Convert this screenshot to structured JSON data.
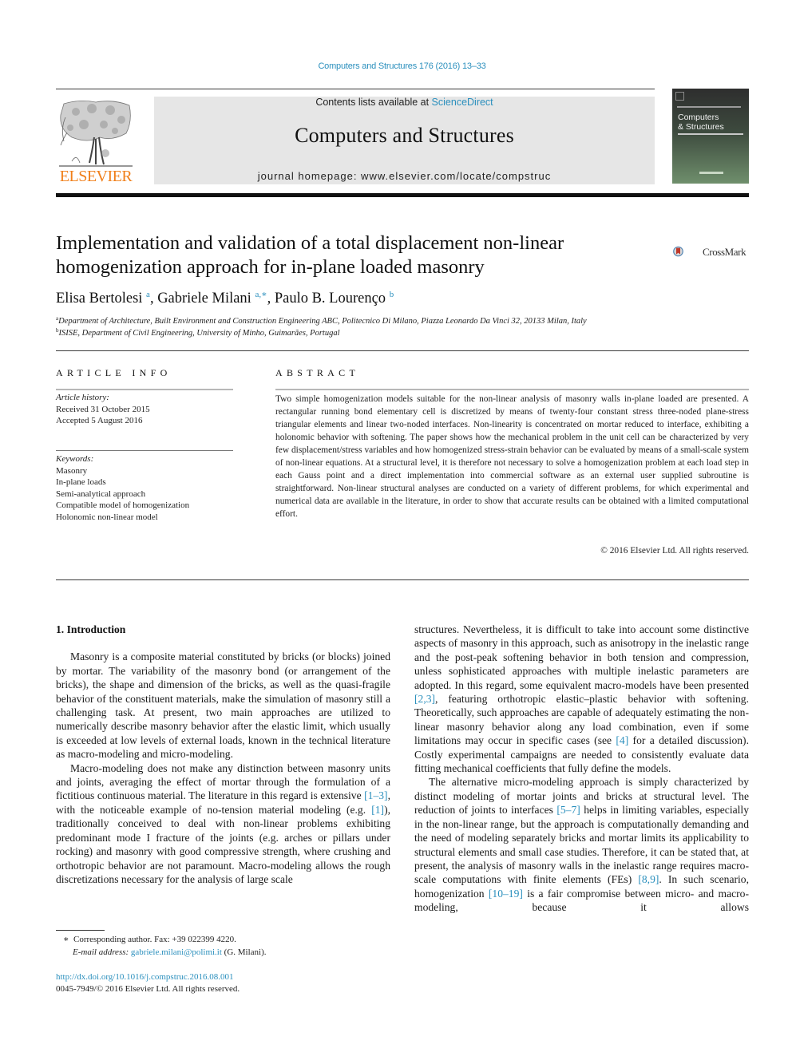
{
  "header": {
    "journal_ref": "Computers and Structures 176 (2016) 13–33",
    "contents_prefix": "Contents lists available at ",
    "contents_link": "ScienceDirect",
    "journal_name": "Computers and Structures",
    "homepage_label": "journal homepage: www.elsevier.com/locate/compstruc",
    "publisher_logo_text": "ELSEVIER",
    "cover_title_line1": "Computers",
    "cover_title_line2": "& Structures",
    "accent_color": "#2a8fbd",
    "publisher_color": "#f07f1a"
  },
  "article": {
    "title_line1": "Implementation and validation of a total displacement non-linear",
    "title_line2": "homogenization approach for in-plane loaded masonry",
    "crossmark_label": "CrossMark",
    "authors": [
      {
        "name": "Elisa Bertolesi",
        "sup": "a",
        "sep": ", "
      },
      {
        "name": "Gabriele Milani",
        "sup": "a,∗",
        "sep": ", "
      },
      {
        "name": "Paulo B. Lourenço",
        "sup": "b",
        "sep": ""
      }
    ],
    "affiliations": [
      {
        "mark": "a",
        "text": "Department of Architecture, Built Environment and Construction Engineering ABC, Politecnico Di Milano, Piazza Leonardo Da Vinci 32, 20133 Milan, Italy"
      },
      {
        "mark": "b",
        "text": "ISISE, Department of Civil Engineering, University of Minho, Guimarães, Portugal"
      }
    ]
  },
  "article_info": {
    "heading": "ARTICLE INFO",
    "history_label": "Article history:",
    "received": "Received 31 October 2015",
    "accepted": "Accepted 5 August 2016",
    "keywords_label": "Keywords:",
    "keywords": [
      "Masonry",
      "In-plane loads",
      "Semi-analytical approach",
      "Compatible model of homogenization",
      "Holonomic non-linear model"
    ]
  },
  "abstract": {
    "heading": "ABSTRACT",
    "text": "Two simple homogenization models suitable for the non-linear analysis of masonry walls in-plane loaded are presented. A rectangular running bond elementary cell is discretized by means of twenty-four constant stress three-noded plane-stress triangular elements and linear two-noded interfaces. Non-linearity is concentrated on mortar reduced to interface, exhibiting a holonomic behavior with softening. The paper shows how the mechanical problem in the unit cell can be characterized by very few displacement/stress variables and how homogenized stress-strain behavior can be evaluated by means of a small-scale system of non-linear equations. At a structural level, it is therefore not necessary to solve a homogenization problem at each load step in each Gauss point and a direct implementation into commercial software as an external user supplied subroutine is straightforward. Non-linear structural analyses are conducted on a variety of different problems, for which experimental and numerical data are available in the literature, in order to show that accurate results can be obtained with a limited computational effort.",
    "copyright": "© 2016 Elsevier Ltd. All rights reserved."
  },
  "body": {
    "section_heading": "1. Introduction",
    "p1": "Masonry is a composite material constituted by bricks (or blocks) joined by mortar. The variability of the masonry bond (or arrangement of the bricks), the shape and dimension of the bricks, as well as the quasi-fragile behavior of the constituent materials, make the simulation of masonry still a challenging task. At present, two main approaches are utilized to numerically describe masonry behavior after the elastic limit, which usually is exceeded at low levels of external loads, known in the technical literature as macro-modeling and micro-modeling.",
    "p2": {
      "t1": "Macro-modeling does not make any distinction between masonry units and joints, averaging the effect of mortar through the formulation of a fictitious continuous material. The literature in this regard is extensive ",
      "r1": "[1–3]",
      "t2": ", with the noticeable example of no-tension material modeling (e.g. ",
      "r2": "[1]",
      "t3": "), traditionally conceived to deal with non-linear problems exhibiting predominant mode I fracture of the joints (e.g. arches or pillars under rocking) and masonry with good compressive strength, where crushing and orthotropic behavior are not paramount. Macro-modeling allows the rough discretizations necessary for the analysis of large scale"
    },
    "p2_cont": {
      "t1": "structures. Nevertheless, it is difficult to take into account some distinctive aspects of masonry in this approach, such as anisotropy in the inelastic range and the post-peak softening behavior in both tension and compression, unless sophisticated approaches with multiple inelastic parameters are adopted. In this regard, some equivalent macro-models have been presented ",
      "r1": "[2,3]",
      "t2": ", featuring orthotropic elastic–plastic behavior with softening. Theoretically, such approaches are capable of adequately estimating the non-linear masonry behavior along any load combination, even if some limitations may occur in specific cases (see ",
      "r2": "[4]",
      "t3": " for a detailed discussion). Costly experimental campaigns are needed to consistently evaluate data fitting mechanical coefficients that fully define the models."
    },
    "p3": {
      "t1": "The alternative micro-modeling approach is simply characterized by distinct modeling of mortar joints and bricks at structural level. The reduction of joints to interfaces ",
      "r1": "[5–7]",
      "t2": " helps in limiting variables, especially in the non-linear range, but the approach is computationally demanding and the need of modeling separately bricks and mortar limits its applicability to structural elements and small case studies. Therefore, it can be stated that, at present, the analysis of masonry walls in the inelastic range requires macro-scale computations with finite elements (FEs) ",
      "r2": "[8,9]",
      "t3": ". In such scenario, homogenization ",
      "r3": "[10–19]",
      "t4": " is a fair compromise between micro- and macro-modeling, because it allows"
    }
  },
  "footnotes": {
    "corresponding_mark": "∗",
    "corresponding": "Corresponding author. Fax: +39 022399 4220.",
    "email_label": "E-mail address: ",
    "email": "gabriele.milani@polimi.it",
    "email_suffix": " (G. Milani).",
    "doi": "http://dx.doi.org/10.1016/j.compstruc.2016.08.001",
    "issn_copyright": "0045-7949/© 2016 Elsevier Ltd. All rights reserved."
  }
}
